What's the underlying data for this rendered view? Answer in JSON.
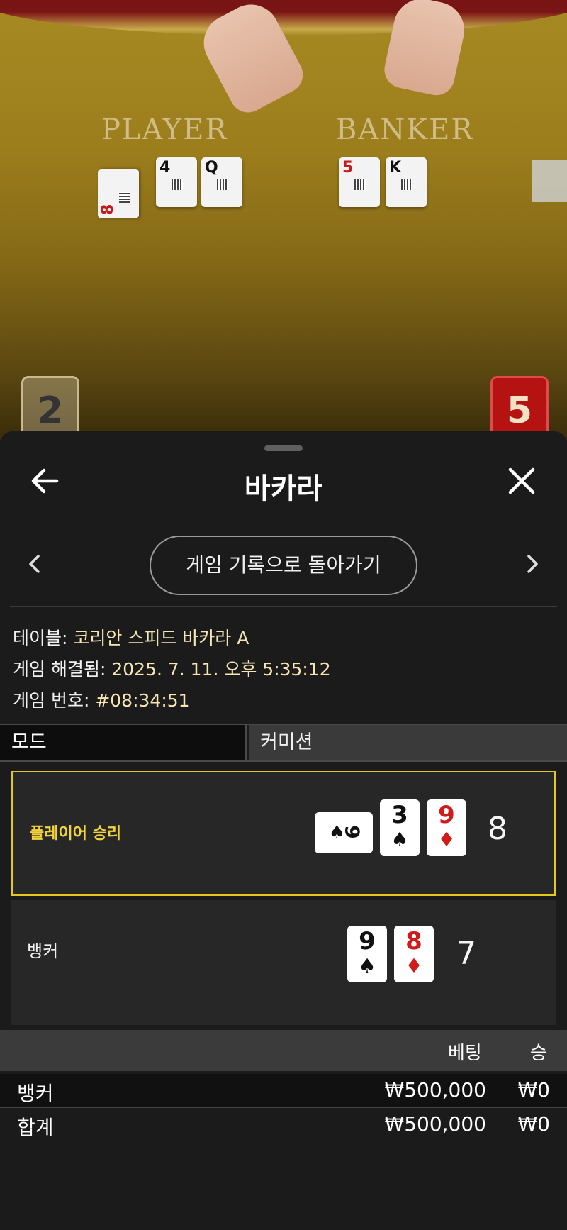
{
  "video": {
    "player_label": "PLAYER",
    "banker_label": "BANKER",
    "player_cards": [
      {
        "rank": "8",
        "suit": "♥",
        "color": "red"
      },
      {
        "rank": "4",
        "suit": "♣",
        "color": "black"
      },
      {
        "rank": "Q",
        "suit": "♠",
        "color": "black"
      }
    ],
    "banker_cards": [
      {
        "rank": "5",
        "suit": "♦",
        "color": "red"
      },
      {
        "rank": "K",
        "suit": "♠",
        "color": "black"
      }
    ],
    "player_score": "2",
    "banker_score": "5"
  },
  "header": {
    "back_icon": "arrow-left-icon",
    "title": "바카라",
    "close_icon": "close-icon"
  },
  "navigation": {
    "prev_icon": "chevron-left-icon",
    "next_icon": "chevron-right-icon",
    "history_button": "게임 기록으로 돌아가기"
  },
  "info": {
    "table_key": "테이블: ",
    "table_value": "코리안 스피드 바카라 A",
    "resolved_key": "게임 해결됨: ",
    "resolved_value": "2025. 7. 11. 오후 5:35:12",
    "number_key": "게임 번호: ",
    "number_value": "#08:34:51"
  },
  "tabs": {
    "mode": "모드",
    "commission": "커미션"
  },
  "outcomes": {
    "player": {
      "label": "플레이어 승리",
      "cards": [
        {
          "rank": "9",
          "suit": "♠",
          "color": "black",
          "orientation": "sideways"
        },
        {
          "rank": "3",
          "suit": "♠",
          "color": "black"
        },
        {
          "rank": "9",
          "suit": "♦",
          "color": "red"
        }
      ],
      "total": "8",
      "highlight_color": "#e3c820"
    },
    "banker": {
      "label": "뱅커",
      "cards": [
        {
          "rank": "9",
          "suit": "♠",
          "color": "black"
        },
        {
          "rank": "8",
          "suit": "♦",
          "color": "red"
        }
      ],
      "total": "7"
    }
  },
  "bets": {
    "header_bet": "베팅",
    "header_win": "승",
    "rows": [
      {
        "label": "뱅커",
        "bet": "₩500,000",
        "win": "₩0"
      },
      {
        "label": "합계",
        "bet": "₩500,000",
        "win": "₩0"
      }
    ]
  }
}
